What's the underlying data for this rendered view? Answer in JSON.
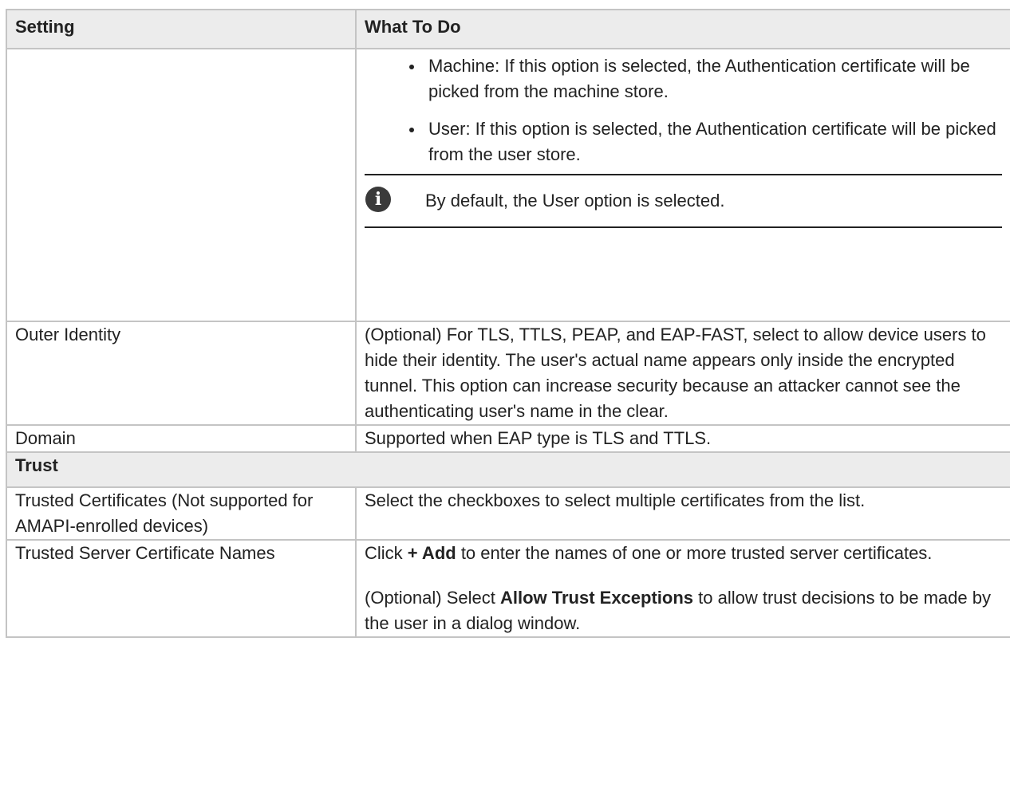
{
  "table": {
    "headers": {
      "setting": "Setting",
      "what_to_do": "What To Do"
    },
    "cert_store_row": {
      "options": [
        {
          "text": "Machine: If this option is selected, the Authentication certificate will be picked from the machine store."
        },
        {
          "text": "User: If this option is selected, the Authentication certificate will be picked from the user store."
        }
      ],
      "note": "By default, the User option is selected."
    },
    "outer_identity": {
      "setting": "Outer Identity",
      "text": "(Optional) For TLS, TTLS, PEAP, and EAP-FAST, select to allow device users to hide their identity. The user's actual name appears only inside the encrypted tunnel. This option can increase security because an attacker cannot see the authenticating user's name in the clear."
    },
    "domain": {
      "setting": "Domain",
      "text": "Supported when EAP type is TLS and TTLS."
    },
    "section_trust": "Trust",
    "trusted_certificates": {
      "setting": "Trusted Certificates (Not supported for AMAPI-enrolled devices)",
      "text": "Select the checkboxes to select multiple certificates from the list."
    },
    "trusted_server_names": {
      "setting": "Trusted Server Certificate Names",
      "p1_before": "Click ",
      "p1_bold": "+ Add",
      "p1_after": " to enter the names of one or more trusted server certificates.",
      "p2_before": "(Optional) Select ",
      "p2_bold": "Allow Trust Exceptions",
      "p2_after": " to allow trust decisions to be made by the user in a dialog window."
    }
  },
  "icons": {
    "note_icon": "info-icon"
  }
}
